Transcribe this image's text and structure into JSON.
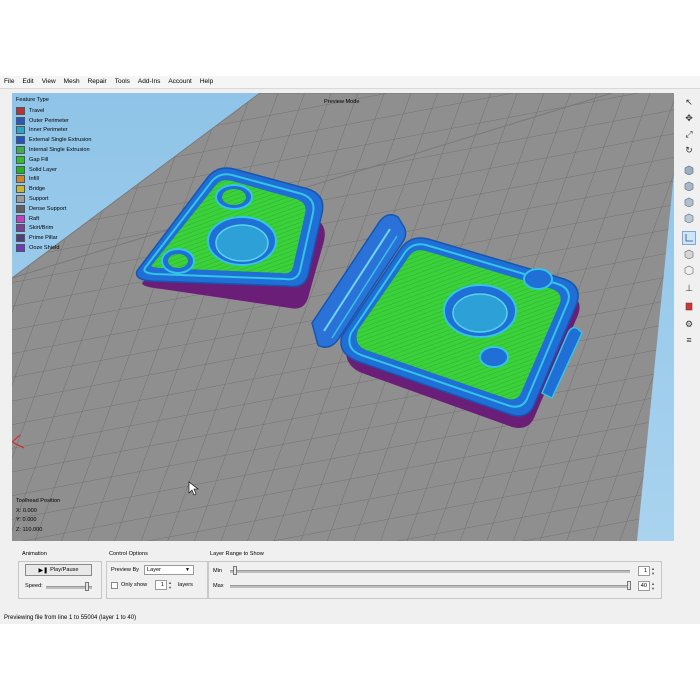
{
  "menu": [
    "File",
    "Edit",
    "View",
    "Mesh",
    "Repair",
    "Tools",
    "Add-Ins",
    "Account",
    "Help"
  ],
  "legend": {
    "title": "Feature Type",
    "items": [
      {
        "label": "Travel",
        "color": "#b2343a"
      },
      {
        "label": "Outer Perimeter",
        "color": "#2a56b6"
      },
      {
        "label": "Inner Perimeter",
        "color": "#2aa3c9"
      },
      {
        "label": "External Single Extrusion",
        "color": "#1f55c2"
      },
      {
        "label": "Internal Single Extrusion",
        "color": "#3cae4a"
      },
      {
        "label": "Gap Fill",
        "color": "#2ec12e"
      },
      {
        "label": "Solid Layer",
        "color": "#22b322"
      },
      {
        "label": "Infill",
        "color": "#c9892f"
      },
      {
        "label": "Bridge",
        "color": "#c8b63a"
      },
      {
        "label": "Support",
        "color": "#9a9a9a"
      },
      {
        "label": "Dense Support",
        "color": "#606060"
      },
      {
        "label": "Raft",
        "color": "#c23ec2"
      },
      {
        "label": "Skirt/Brim",
        "color": "#7a3f9a"
      },
      {
        "label": "Prime Pillar",
        "color": "#4f3f7a"
      },
      {
        "label": "Ooze Shield",
        "color": "#6a3db8"
      }
    ]
  },
  "viewport": {
    "mode_label": "Preview Mode",
    "toolhead_title": "Toolhead Position",
    "x": "X: 0.000",
    "y": "Y: 0.000",
    "z": "Z: 110.000"
  },
  "toolbar_icons": [
    "pointer-icon",
    "move-icon",
    "scale-icon",
    "rotate-icon",
    "view-front-icon",
    "view-back-icon",
    "view-left-icon",
    "view-right-icon",
    "view-top-icon",
    "view-bottom-icon",
    "view-iso-icon",
    "axes-icon",
    "section-icon",
    "settings-icon",
    "layers-icon"
  ],
  "animation": {
    "label": "Animation",
    "play_label": "Play/Pause",
    "speed_label": "Speed:",
    "speed_level": 0.9
  },
  "control": {
    "label": "Control Options",
    "preview_by_label": "Preview By",
    "preview_by_value": "Layer",
    "only_show_label": "Only show",
    "only_show_value": "1",
    "layers_label": "layers"
  },
  "range": {
    "label": "Layer Range to Show",
    "min_label": "Min",
    "min_value": "1",
    "max_label": "Max",
    "max_value": "40"
  },
  "status": "Previewing file from line 1 to 55004 (layer 1 to 40)"
}
